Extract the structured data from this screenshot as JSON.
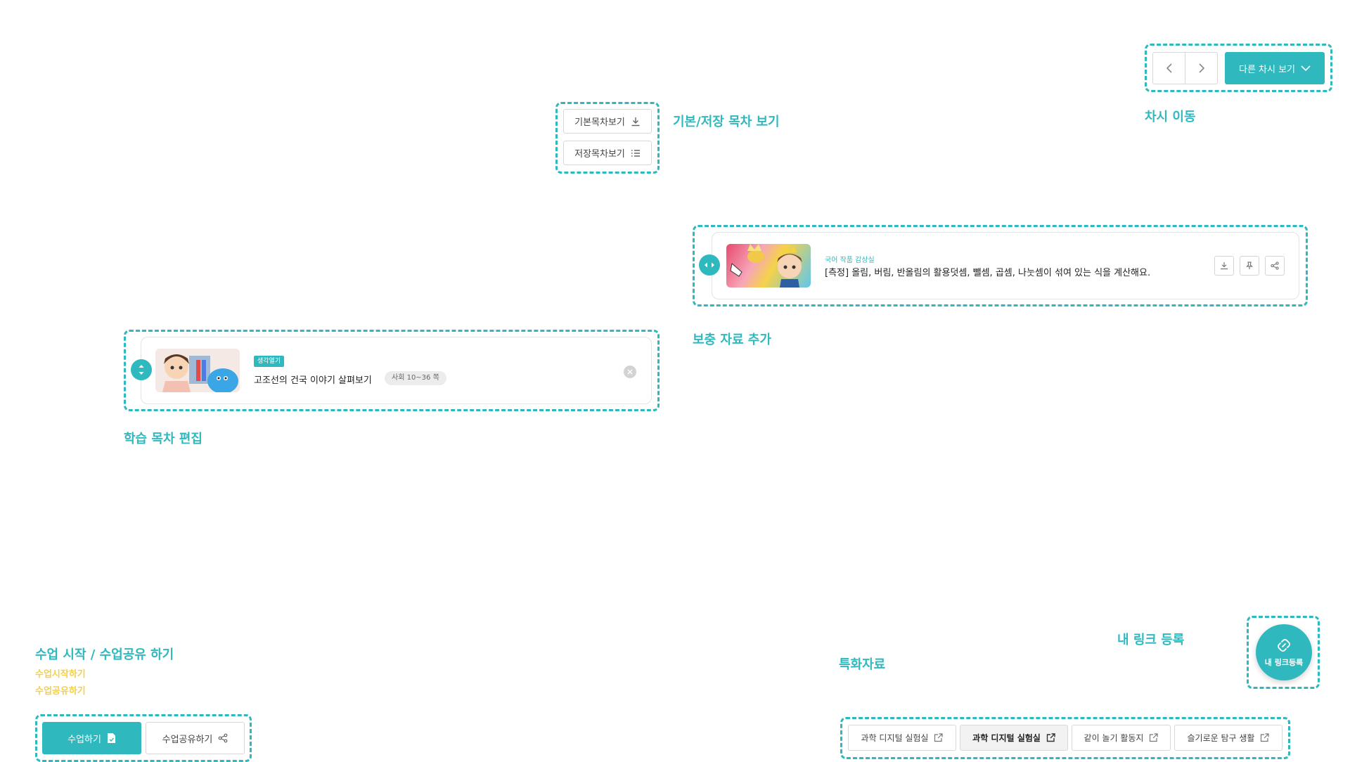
{
  "annotations": {
    "toc_view": "기본/저장 목차 보기",
    "session_move": "차시 이동",
    "supplement_add": "보충 자료 추가",
    "toc_edit": "학습 목차 편집",
    "class_start_share": "수업 시작 / 수업공유 하기",
    "class_start_sub": "수업시작하기",
    "class_share_sub": "수업공유하기",
    "special_materials": "특화자료",
    "my_link_register": "내 링크 등록"
  },
  "toc_buttons": {
    "basic": "기본목차보기",
    "saved": "저장목차보기"
  },
  "session_nav": {
    "other_session": "다른 차시 보기"
  },
  "supplement_card": {
    "category": "국어 작품 감상실",
    "title": "[측정] 올림, 버림, 반올림의 활용덧셈, 뺄셈, 곱셈, 나눗셈이 섞여 있는 식을 계산해요."
  },
  "toc_card": {
    "badge": "생각열기",
    "title": "고조선의 건국 이야기 살펴보기",
    "page_tag": "사회 10~36 쪽"
  },
  "class_buttons": {
    "start": "수업하기",
    "share": "수업공유하기"
  },
  "special_links": [
    {
      "label": "과학 디지털 실험실",
      "active": false
    },
    {
      "label": "과학 디지털 실험실",
      "active": true
    },
    {
      "label": "같이 놀기 활동지",
      "active": false
    },
    {
      "label": "슬기로운 탐구 생활",
      "active": false
    }
  ],
  "my_link": {
    "label": "내 링크등록"
  },
  "colors": {
    "accent": "#2fb9be",
    "sub_annotation": "#f3cf4a",
    "border": "#d7d7d7"
  }
}
